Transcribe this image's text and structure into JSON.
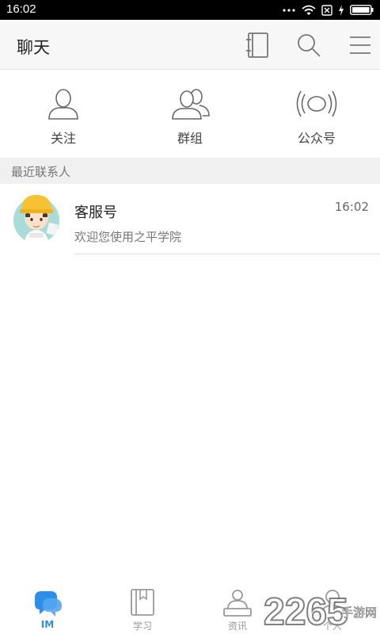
{
  "status_bar": {
    "time": "16:02"
  },
  "header": {
    "title": "聊天",
    "icons": [
      "contacts-book-icon",
      "search-icon",
      "menu-icon"
    ]
  },
  "quick_actions": [
    {
      "label": "关注",
      "icon": "user-icon"
    },
    {
      "label": "群组",
      "icon": "group-icon"
    },
    {
      "label": "公众号",
      "icon": "broadcast-icon"
    }
  ],
  "section": {
    "title": "最近联系人"
  },
  "contacts": [
    {
      "name": "客服号",
      "time": "16:02",
      "message": "欢迎您使用之平学院"
    }
  ],
  "tabs": [
    {
      "label": "IM",
      "icon": "chat-bubbles-icon",
      "active": true
    },
    {
      "label": "学习",
      "icon": "book-icon",
      "active": false
    },
    {
      "label": "资讯",
      "icon": "news-icon",
      "active": false
    },
    {
      "label": "个人",
      "icon": "person-icon",
      "active": false
    }
  ],
  "watermark": {
    "text": "2265",
    "sub": "手游网"
  },
  "colors": {
    "accent": "#2e8de6",
    "header_bg": "#f7f7f7",
    "section_bg": "#f0f0f0",
    "status_bar": "#000000"
  }
}
